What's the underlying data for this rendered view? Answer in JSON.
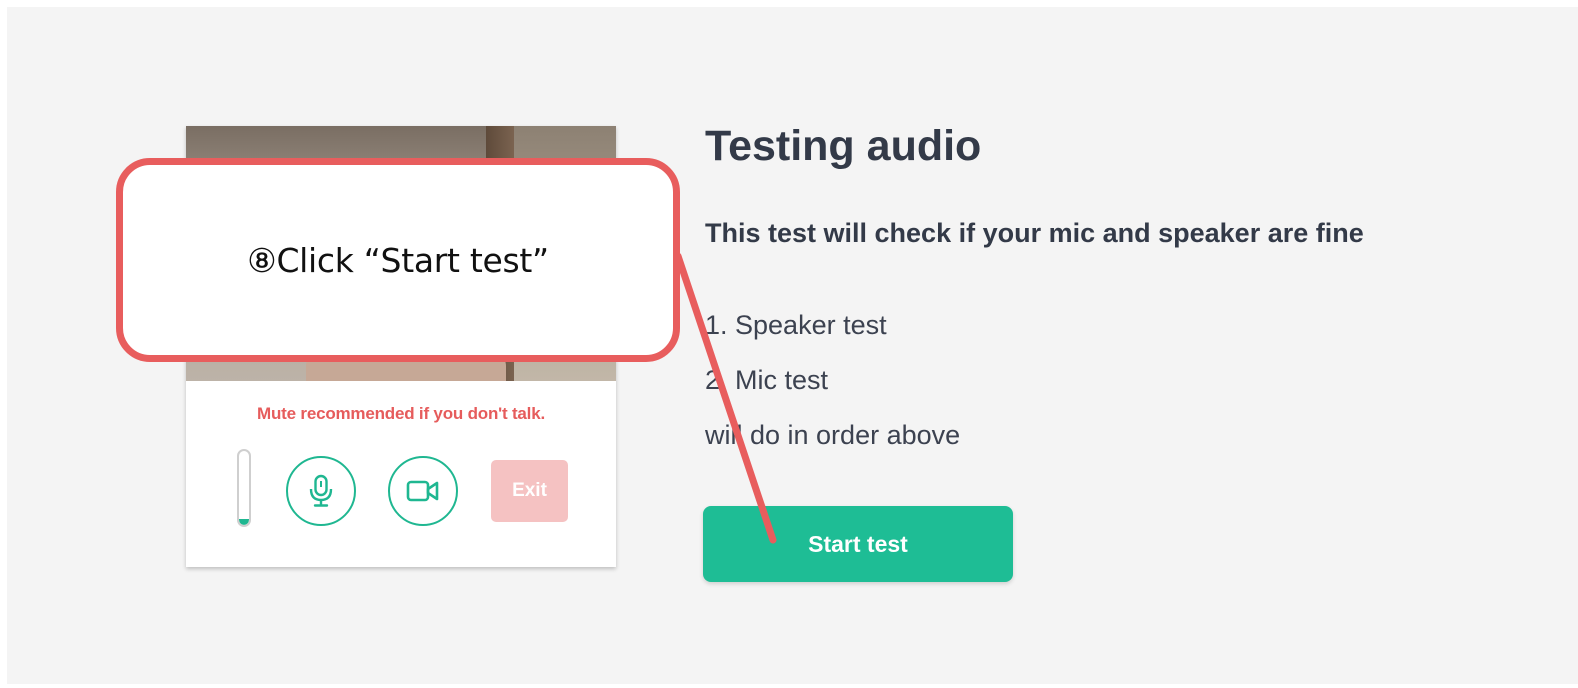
{
  "preview": {
    "mute_note": "Mute recommended if you don't talk.",
    "level": 0.08,
    "mic_button_icon": "microphone-icon",
    "camera_button_icon": "video-camera-icon",
    "exit_label": "Exit"
  },
  "test": {
    "title": "Testing audio",
    "subtitle": "This test will check if your mic and speaker are fine",
    "steps": [
      "1. Speaker test",
      "2. Mic test",
      "will do in order above"
    ],
    "start_label": "Start test"
  },
  "callout": {
    "text": "⑧Click “Start test”"
  },
  "colors": {
    "accent": "#1ebd95",
    "warning": "#e65c5c",
    "exit_disabled": "#f5c2c2",
    "callout_border": "#e85d5d",
    "text_dark": "#333a48",
    "background": "#f4f4f4"
  }
}
